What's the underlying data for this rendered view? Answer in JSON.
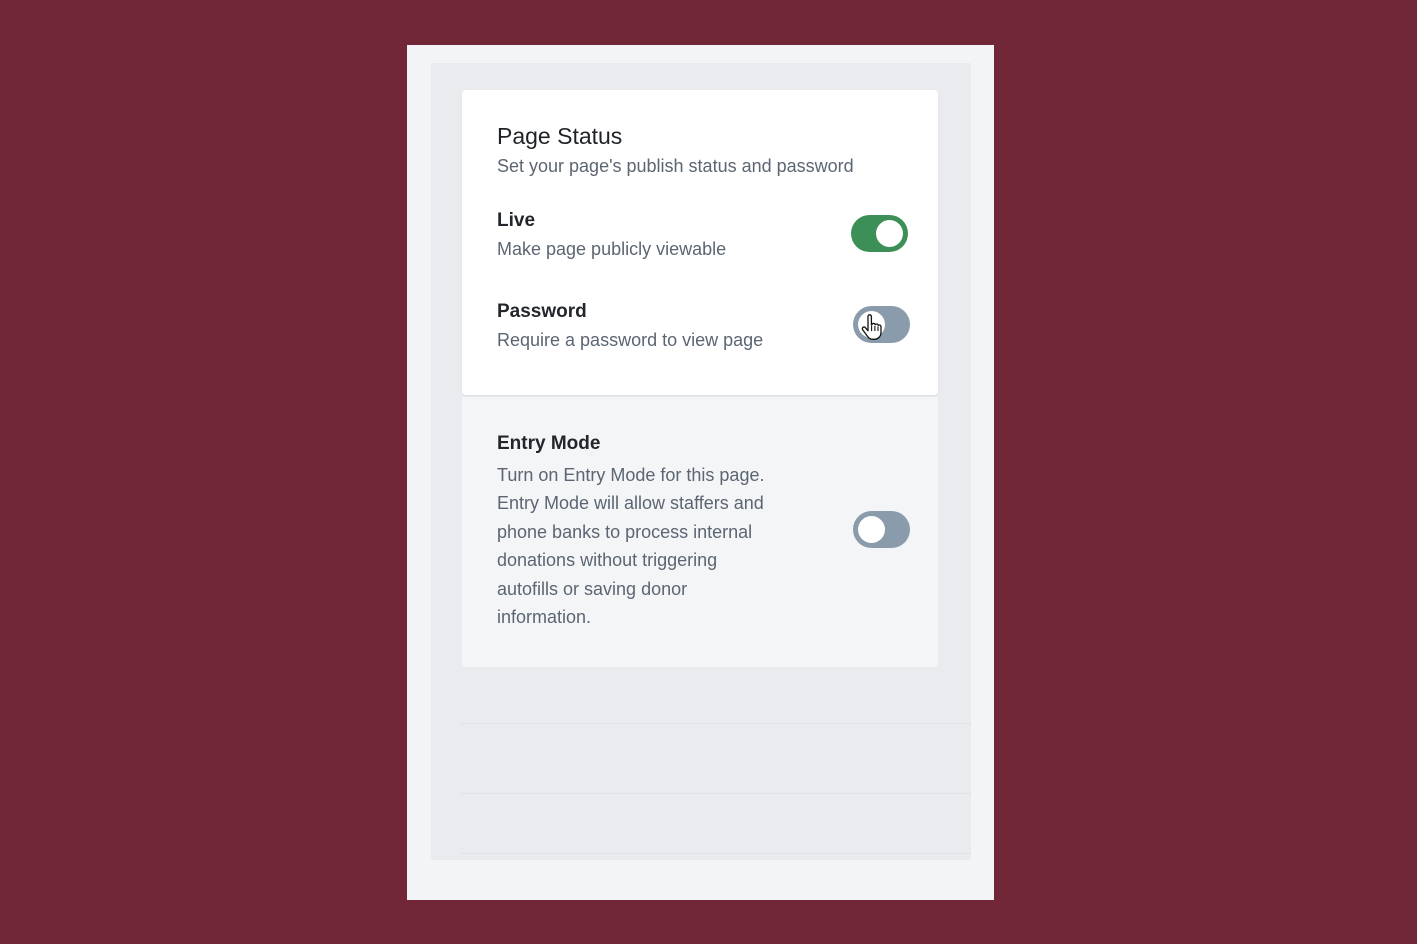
{
  "page_status": {
    "title": "Page Status",
    "subtitle": "Set your page's publish status and password"
  },
  "settings": [
    {
      "id": "live",
      "label": "Live",
      "description": "Make page publicly viewable",
      "enabled": true
    },
    {
      "id": "password",
      "label": "Password",
      "description": "Require a password to view page",
      "enabled": false
    }
  ],
  "entry_mode": {
    "label": "Entry Mode",
    "description_lines": [
      "Turn on Entry Mode for this page.",
      "Entry Mode will allow staffers and",
      "phone banks to process internal",
      "donations without triggering",
      "autofills or saving donor",
      "information."
    ],
    "enabled": false
  },
  "colors": {
    "background": "#722739",
    "toggle_on": "#3d8f58",
    "toggle_off": "#8a9bab"
  },
  "icons": {
    "cursor": "hand-pointer-icon"
  }
}
